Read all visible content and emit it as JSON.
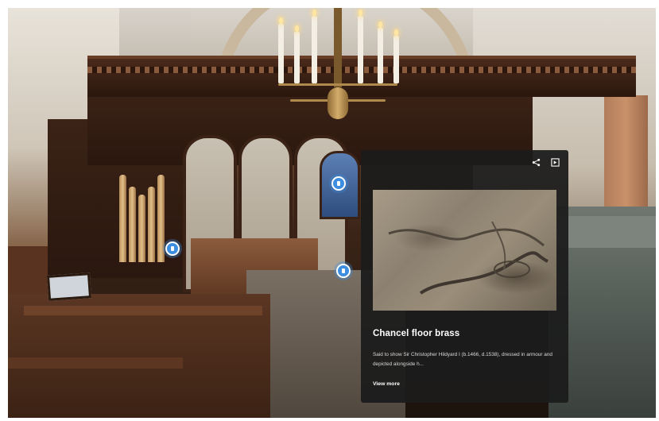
{
  "tour": {
    "hotspots": [
      {
        "name": "info-hotspot-organ"
      },
      {
        "name": "info-hotspot-altar"
      },
      {
        "name": "info-hotspot-window"
      }
    ]
  },
  "card": {
    "title": "Chancel floor brass",
    "description": "Said to show Sir Christopher Hildyard I (b.1466, d.1538), dressed in armour and depicted alongside h...",
    "link_label": "View more",
    "share_icon": "share-icon",
    "expand_icon": "expand-icon",
    "accent": "#3d8ee0"
  }
}
